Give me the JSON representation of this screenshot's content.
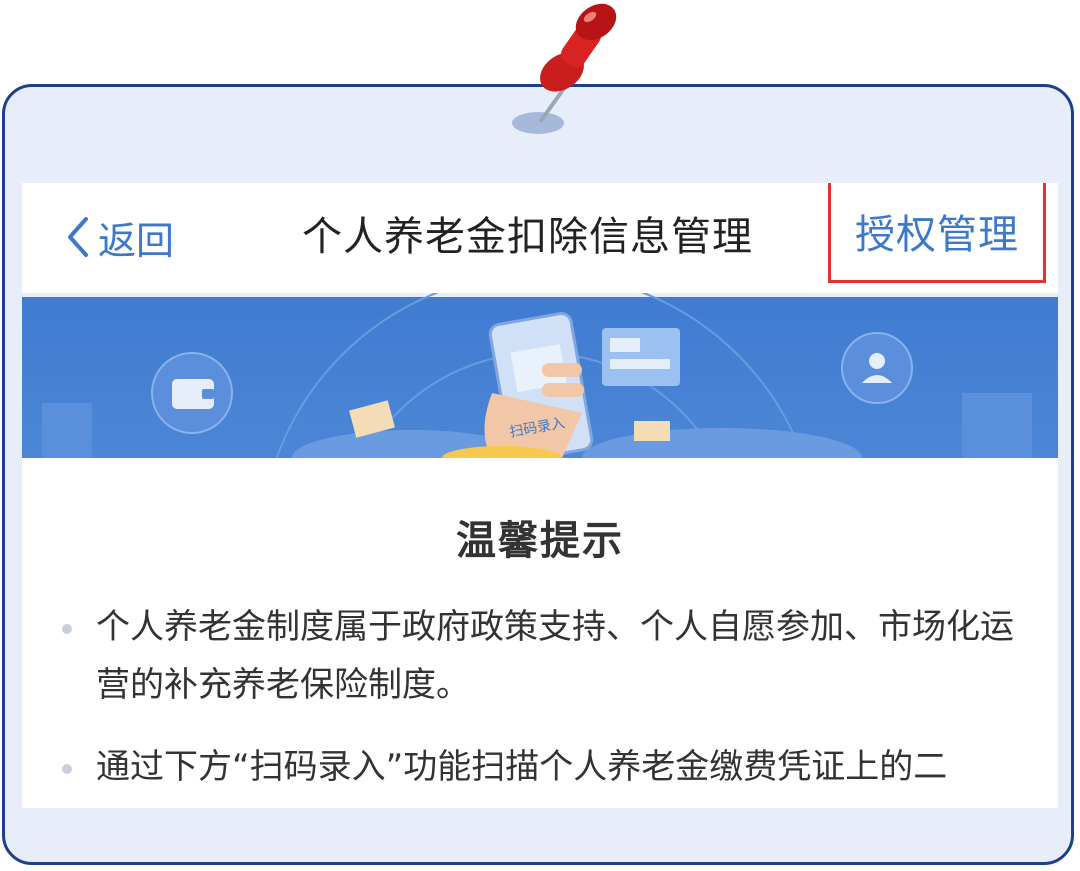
{
  "nav": {
    "back_label": "返回",
    "title": "个人养老金扣除信息管理",
    "auth_label": "授权管理"
  },
  "banner": {
    "phone_label": "扫码录入"
  },
  "tips": {
    "title": "温馨提示",
    "items": [
      "个人养老金制度属于政府政策支持、个人自愿参加、市场化运营的补充养老保险制度。",
      "通过下方“扫码录入”功能扫描个人养老金缴费凭证上的二"
    ]
  },
  "colors": {
    "accent": "#3e78c9",
    "highlight_border": "#e23333",
    "card_border": "#1e3f8c",
    "card_bg": "#e8eef9"
  },
  "icons": [
    "pushpin-icon",
    "chevron-left-icon",
    "wallet-icon",
    "user-icon",
    "phone-illustration"
  ]
}
